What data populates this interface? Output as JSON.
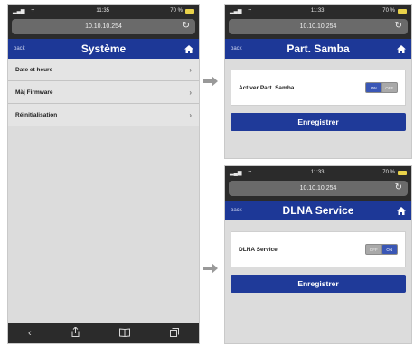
{
  "phone1": {
    "status": {
      "time": "11:35",
      "battery": "70 %"
    },
    "url": "10.10.10.254",
    "nav": {
      "back": "back",
      "title": "Système"
    },
    "menu": [
      {
        "label": "Date et heure"
      },
      {
        "label": "Màj Firmware"
      },
      {
        "label": "Réinitialisation"
      }
    ]
  },
  "phone2": {
    "status": {
      "time": "11:33",
      "battery": "70 %"
    },
    "url": "10.10.10.254",
    "nav": {
      "back": "back",
      "title": "Part. Samba"
    },
    "setting": {
      "label": "Activer Part. Samba",
      "toggle_on": "ON",
      "toggle_off": "OFF",
      "state": "on"
    },
    "save_label": "Enregistrer"
  },
  "phone3": {
    "status": {
      "time": "11:33",
      "battery": "70 %"
    },
    "url": "10.10.10.254",
    "nav": {
      "back": "back",
      "title": "DLNA Service"
    },
    "setting": {
      "label": "DLNA Service",
      "toggle_off": "OFF",
      "toggle_on": "ON",
      "state": "on"
    },
    "save_label": "Enregistrer"
  },
  "colors": {
    "navbar": "#1d3897",
    "button": "#1f3a99",
    "chrome": "#2b2b2b",
    "arrow": "#999999"
  }
}
